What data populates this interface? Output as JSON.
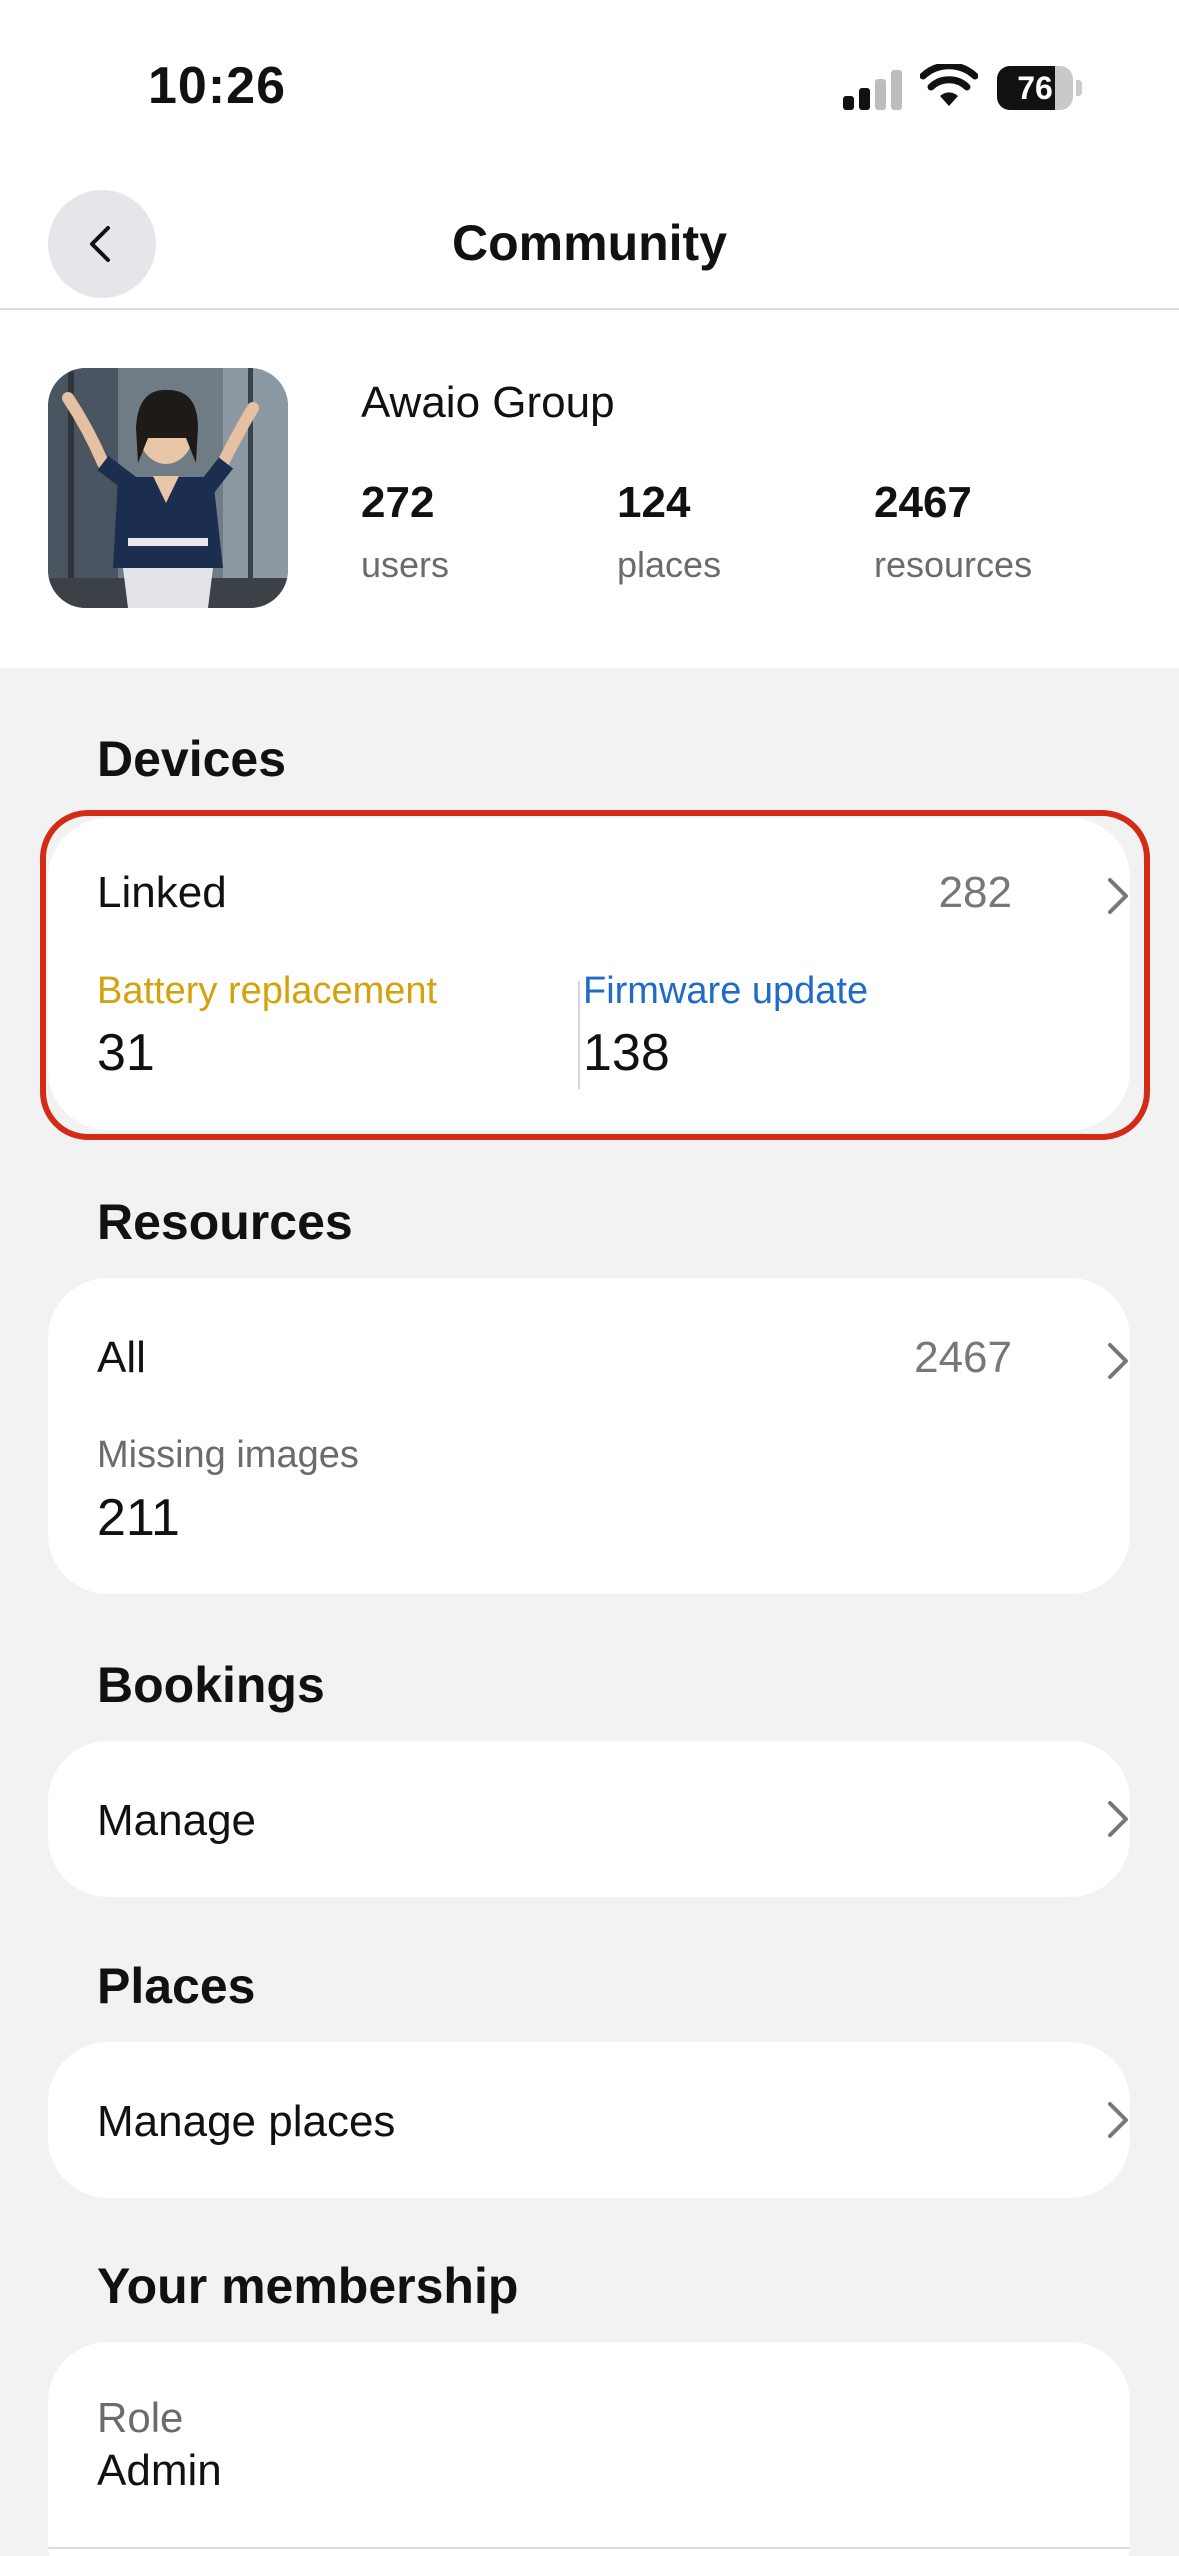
{
  "status_bar": {
    "time": "10:26",
    "battery": "76",
    "battery_level": 0.76,
    "icons": [
      "cellular-signal-icon",
      "wifi-icon",
      "battery-icon"
    ]
  },
  "nav": {
    "title": "Community",
    "back_icon": "chevron-left-icon"
  },
  "community": {
    "name": "Awaio Group",
    "stats": [
      {
        "value": "272",
        "label": "users"
      },
      {
        "value": "124",
        "label": "places"
      },
      {
        "value": "2467",
        "label": "resources"
      }
    ]
  },
  "devices": {
    "title": "Devices",
    "linked_label": "Linked",
    "linked_count": "282",
    "battery_label": "Battery replacement",
    "battery_value": "31",
    "firmware_label": "Firmware update",
    "firmware_value": "138"
  },
  "resources": {
    "title": "Resources",
    "all_label": "All",
    "all_count": "2467",
    "missing_label": "Missing images",
    "missing_value": "211"
  },
  "bookings": {
    "title": "Bookings",
    "manage_label": "Manage"
  },
  "places": {
    "title": "Places",
    "manage_label": "Manage places"
  },
  "membership": {
    "title": "Your membership",
    "role_label": "Role",
    "role_value": "Admin"
  },
  "colors": {
    "battery_accent": "#d4a20c",
    "firmware_accent": "#1f6bc9",
    "highlight_border": "#d42b17",
    "page_background": "#f2f2f2"
  }
}
